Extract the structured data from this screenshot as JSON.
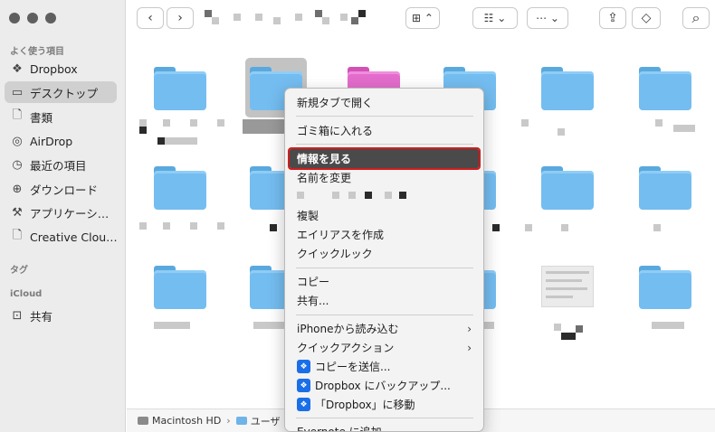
{
  "sidebar": {
    "favorites_label": "よく使う項目",
    "items": [
      {
        "label": "Dropbox",
        "icon": "dropbox-icon",
        "glyph": "❖"
      },
      {
        "label": "デスクトップ",
        "icon": "desktop-icon",
        "glyph": "▭"
      },
      {
        "label": "書類",
        "icon": "document-icon",
        "glyph": "🗋"
      },
      {
        "label": "AirDrop",
        "icon": "airdrop-icon",
        "glyph": "◎"
      },
      {
        "label": "最近の項目",
        "icon": "clock-icon",
        "glyph": "◷"
      },
      {
        "label": "ダウンロード",
        "icon": "download-icon",
        "glyph": "⊕"
      },
      {
        "label": "アプリケーシ…",
        "icon": "applications-icon",
        "glyph": "⚒"
      },
      {
        "label": "Creative Clou…",
        "icon": "file-icon",
        "glyph": "🗋"
      }
    ],
    "tags_label": "タグ",
    "icloud_label": "iCloud",
    "icloud_items": [
      {
        "label": "共有",
        "icon": "shared-folder-icon",
        "glyph": "⊡"
      }
    ]
  },
  "toolbar": {
    "back_glyph": "‹",
    "forward_glyph": "›",
    "view_glyph": "⊞ ⌃",
    "group_glyph": "☷ ⌄",
    "action_glyph": "⋯ ⌄",
    "share_glyph": "⇪",
    "tag_glyph": "◇",
    "search_glyph": "⌕"
  },
  "pathbar": {
    "disk": "Macintosh HD",
    "separator": "›",
    "folder": "ユーザ"
  },
  "context_menu": {
    "items": [
      {
        "label": "新規タブで開く"
      },
      {
        "label": "ゴミ箱に入れる"
      },
      {
        "label": "情報を見る",
        "highlighted": true
      },
      {
        "label": "名前を変更"
      },
      {
        "label": "複製"
      },
      {
        "label": "エイリアスを作成"
      },
      {
        "label": "クイックルック"
      },
      {
        "label": "コピー"
      },
      {
        "label": "共有..."
      },
      {
        "label": "iPhoneから読み込む",
        "submenu": true
      },
      {
        "label": "クイックアクション",
        "submenu": true
      },
      {
        "label": "コピーを送信...",
        "dropbox": true
      },
      {
        "label": "Dropbox にバックアップ...",
        "dropbox": true
      },
      {
        "label": "「Dropbox」に移動",
        "dropbox": true
      },
      {
        "label": "Evernote に追加"
      }
    ],
    "submenu_glyph": "›",
    "dropbox_glyph": "❖"
  },
  "colors": {
    "folder_blue": "#74bdf0",
    "folder_pink": "#e36ccc",
    "highlight_bg": "#4a4a4a",
    "highlight_border": "#d21c1c",
    "dropbox_blue": "#1a6fe8"
  }
}
